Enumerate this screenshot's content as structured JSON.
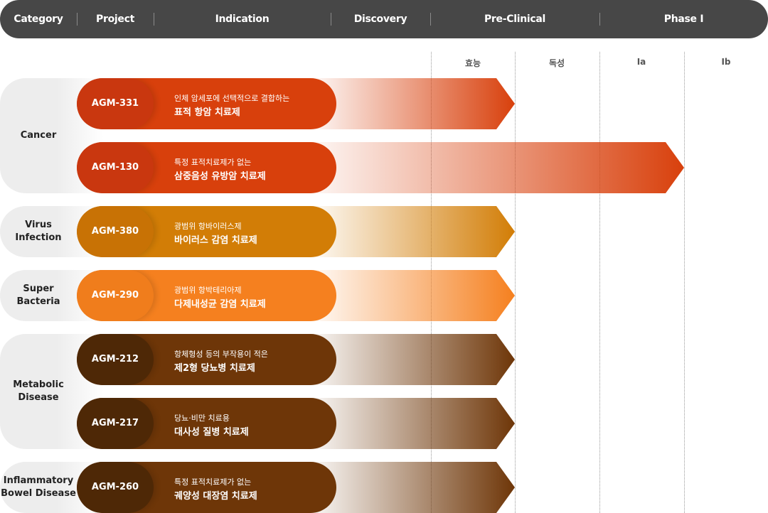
{
  "header": {
    "category": "Category",
    "project": "Project",
    "indication": "Indication",
    "discovery": "Discovery",
    "preclinical": "Pre-Clinical",
    "phase1": "Phase Ⅰ"
  },
  "subheaders": {
    "efficacy": "효능",
    "toxicity": "독성",
    "ia": "Ia",
    "ib": "Ib"
  },
  "categories": [
    {
      "id": "cancer",
      "label": "Cancer"
    },
    {
      "id": "virus",
      "label": "Virus\nInfection"
    },
    {
      "id": "bacteria",
      "label": "Super\nBacteria"
    },
    {
      "id": "metabolic",
      "label": "Metabolic\nDisease"
    },
    {
      "id": "ibd",
      "label": "Inflammatory\nBowel Disease"
    }
  ],
  "chart_data": {
    "type": "bar",
    "stages": [
      "Discovery",
      "효능",
      "독성",
      "Ia",
      "Ib"
    ],
    "projects": [
      {
        "code": "AGM-331",
        "category": "Cancer",
        "line1": "인체 암세포에 선택적으로 결합하는",
        "line2": "표적 항암 치료제",
        "stage_reached": "효능",
        "color": "#d8400c",
        "code_color": "#c9370f"
      },
      {
        "code": "AGM-130",
        "category": "Cancer",
        "line1": "특정 표적치료제가 없는",
        "line2": "삼중음성 유방암 치료제",
        "stage_reached": "Ia",
        "color": "#d8400c",
        "code_color": "#c9370f"
      },
      {
        "code": "AGM-380",
        "category": "Virus Infection",
        "line1": "광범위 항바이러스제",
        "line2": "바이러스 감염 치료제",
        "stage_reached": "효능",
        "color": "#d27d06",
        "code_color": "#c87205"
      },
      {
        "code": "AGM-290",
        "category": "Super Bacteria",
        "line1": "광범위 항박테리아제",
        "line2": "다제내성균 감염 치료제",
        "stage_reached": "효능",
        "color": "#f5801f",
        "code_color": "#f07d1c"
      },
      {
        "code": "AGM-212",
        "category": "Metabolic Disease",
        "line1": "항체형성 등의 부작용이 적은",
        "line2": "제2형 당뇨병 치료제",
        "stage_reached": "효능",
        "color": "#6e3608",
        "code_color": "#4e2806"
      },
      {
        "code": "AGM-217",
        "category": "Metabolic Disease",
        "line1": "당뇨·비만 치료용",
        "line2": "대사성 질병 치료제",
        "stage_reached": "효능",
        "color": "#6e3608",
        "code_color": "#4e2806"
      },
      {
        "code": "AGM-260",
        "category": "Inflammatory Bowel Disease",
        "line1": "특정 표적치료제가 없는",
        "line2": "궤양성 대장염 치료제",
        "stage_reached": "효능",
        "color": "#6e3608",
        "code_color": "#4e2806"
      }
    ]
  }
}
